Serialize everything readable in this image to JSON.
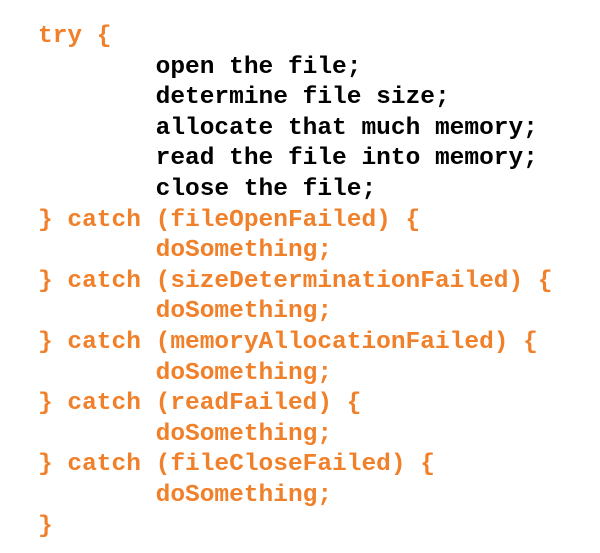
{
  "colors": {
    "keyword_orange": "#f0802a",
    "statement_black": "#000000"
  },
  "code_lines": [
    {
      "text": "try {",
      "color": "orange",
      "indent": 0
    },
    {
      "text": "open the file;",
      "color": "black",
      "indent": 1
    },
    {
      "text": "determine file size;",
      "color": "black",
      "indent": 1
    },
    {
      "text": "allocate that much memory;",
      "color": "black",
      "indent": 1
    },
    {
      "text": "read the file into memory;",
      "color": "black",
      "indent": 1
    },
    {
      "text": "close the file;",
      "color": "black",
      "indent": 1
    },
    {
      "text": "} catch (fileOpenFailed) {",
      "color": "orange",
      "indent": 0
    },
    {
      "text": "doSomething;",
      "color": "orange",
      "indent": 1
    },
    {
      "text": "} catch (sizeDeterminationFailed) {",
      "color": "orange",
      "indent": 0
    },
    {
      "text": "doSomething;",
      "color": "orange",
      "indent": 1
    },
    {
      "text": "} catch (memoryAllocationFailed) {",
      "color": "orange",
      "indent": 0
    },
    {
      "text": "doSomething;",
      "color": "orange",
      "indent": 1
    },
    {
      "text": "} catch (readFailed) {",
      "color": "orange",
      "indent": 0
    },
    {
      "text": "doSomething;",
      "color": "orange",
      "indent": 1
    },
    {
      "text": "} catch (fileCloseFailed) {",
      "color": "orange",
      "indent": 0
    },
    {
      "text": "doSomething;",
      "color": "orange",
      "indent": 1
    },
    {
      "text": "}",
      "color": "orange",
      "indent": 0
    }
  ]
}
